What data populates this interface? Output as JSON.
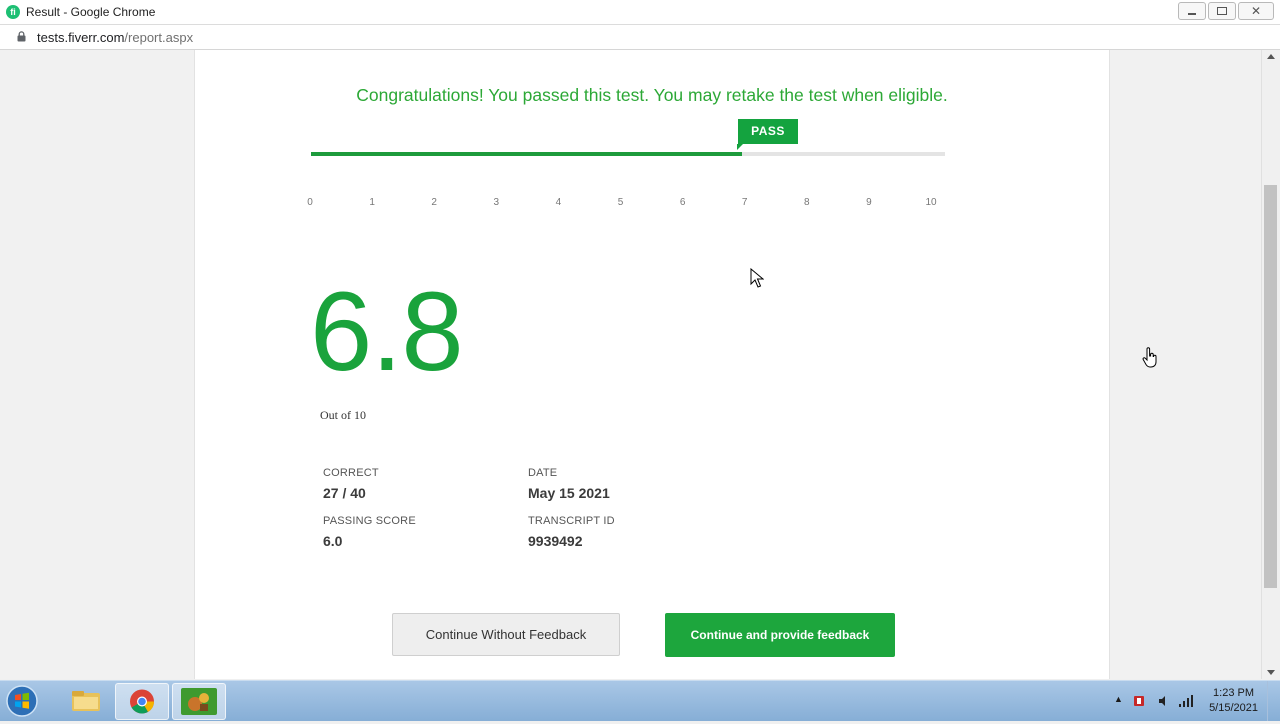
{
  "window": {
    "title": "Result - Google Chrome",
    "favicon_letter": "fi"
  },
  "address": {
    "host": "tests.fiverr.com",
    "path": "/report.aspx"
  },
  "result": {
    "message": "Congratulations! You passed this test. You may retake the test when eligible.",
    "badge": "PASS",
    "score": "6.8",
    "score_value": 6.8,
    "scale_max": 10,
    "out_of": "Out of 10",
    "ticks": [
      "0",
      "1",
      "2",
      "3",
      "4",
      "5",
      "6",
      "7",
      "8",
      "9",
      "10"
    ]
  },
  "stats": {
    "correct_label": "CORRECT",
    "correct_value": "27 / 40",
    "date_label": "DATE",
    "date_value": "May 15 2021",
    "passing_label": "PASSING SCORE",
    "passing_value": "6.0",
    "transcript_label": "TRANSCRIPT ID",
    "transcript_value": "9939492"
  },
  "buttons": {
    "without_feedback": "Continue Without Feedback",
    "with_feedback": "Continue and provide feedback"
  },
  "taskbar": {
    "time": "1:23 PM",
    "date": "5/15/2021",
    "apps": [
      "windows-explorer-icon",
      "chrome-icon",
      "game-icon"
    ]
  },
  "colors": {
    "accent_green": "#1da63d",
    "text_green": "#2ca836"
  }
}
